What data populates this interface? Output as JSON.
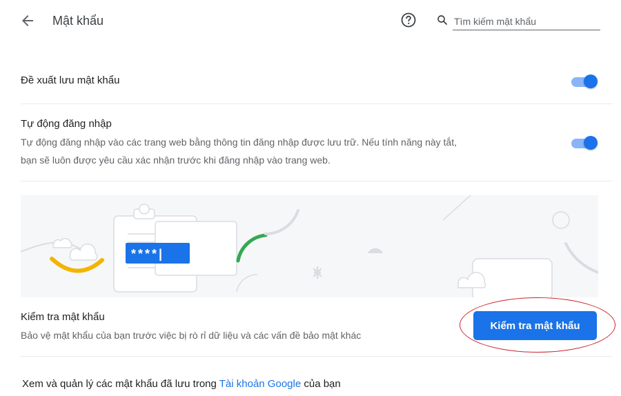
{
  "header": {
    "back_icon": "arrow-back-icon",
    "title": "Mật khẩu",
    "help_icon": "help-circle-icon",
    "search_icon": "search-icon",
    "search_placeholder": "Tìm kiếm mật khẩu"
  },
  "settings": {
    "offer_to_save": {
      "label": "Đề xuất lưu mật khẩu",
      "enabled": true
    },
    "auto_sign_in": {
      "label": "Tự động đăng nhập",
      "description_line1": "Tự động đăng nhập vào các trang web bằng thông tin đăng nhập được lưu trữ. Nếu tính năng này tắt,",
      "description_line2": "bạn sẽ luôn được yêu cầu xác nhận trước khi đăng nhập vào trang web.",
      "enabled": true
    }
  },
  "illustration": {
    "password_mask": "****|"
  },
  "password_check": {
    "title": "Kiểm tra mật khẩu",
    "description": "Bảo vệ mật khẩu của bạn trước việc bị rò rỉ dữ liệu và các vấn đề bảo mật khác",
    "button_label": "Kiểm tra mật khẩu"
  },
  "footer": {
    "text_before": "Xem và quản lý các mật khẩu đã lưu trong ",
    "link_text": "Tài khoản Google",
    "text_after": " của bạn"
  },
  "colors": {
    "accent": "#1a73e8",
    "toggle_track": "#8ab4f8",
    "highlight": "#c8232c"
  }
}
